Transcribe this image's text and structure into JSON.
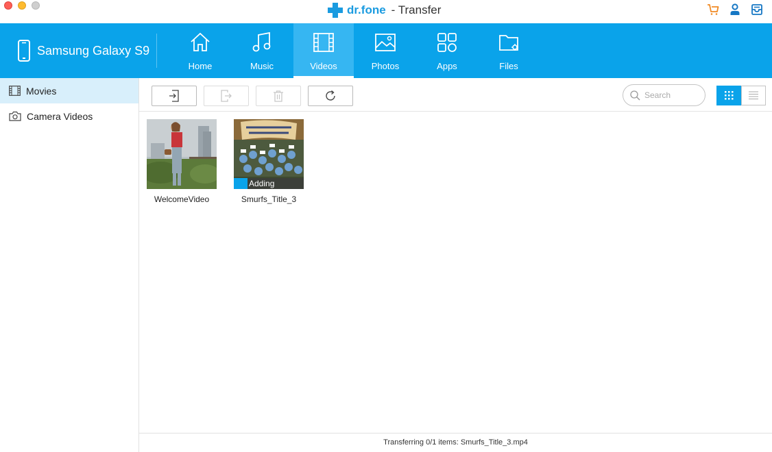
{
  "window": {
    "brand_name": "dr.fone",
    "app_title": "- Transfer"
  },
  "title_icons": [
    "cart-icon",
    "user-icon",
    "inbox-icon"
  ],
  "colors": {
    "accent": "#0aa3ea",
    "cart": "#f08a24",
    "brand": "#1a9be0"
  },
  "device": {
    "name": "Samsung Galaxy S9"
  },
  "nav": {
    "tabs": [
      {
        "label": "Home",
        "icon": "home-icon"
      },
      {
        "label": "Music",
        "icon": "music-icon"
      },
      {
        "label": "Videos",
        "icon": "film-icon",
        "active": true
      },
      {
        "label": "Photos",
        "icon": "image-icon"
      },
      {
        "label": "Apps",
        "icon": "apps-icon"
      },
      {
        "label": "Files",
        "icon": "folder-icon"
      }
    ]
  },
  "sidebar": {
    "items": [
      {
        "label": "Movies",
        "icon": "film-icon",
        "active": true
      },
      {
        "label": "Camera Videos",
        "icon": "camera-icon"
      }
    ]
  },
  "toolbar": {
    "buttons": [
      {
        "name": "import-button",
        "icon": "import-icon",
        "enabled": true
      },
      {
        "name": "export-button",
        "icon": "export-icon",
        "enabled": false
      },
      {
        "name": "delete-button",
        "icon": "trash-icon",
        "enabled": false
      },
      {
        "name": "refresh-button",
        "icon": "refresh-icon",
        "enabled": true
      }
    ],
    "search_placeholder": "Search",
    "view_mode": "grid"
  },
  "videos": [
    {
      "name": "WelcomeVideo"
    },
    {
      "name": "Smurfs_Title_3",
      "status": "Adding",
      "progress": 0.2
    }
  ],
  "status": {
    "text": "Transferring 0/1 items: Smurfs_Title_3.mp4"
  }
}
